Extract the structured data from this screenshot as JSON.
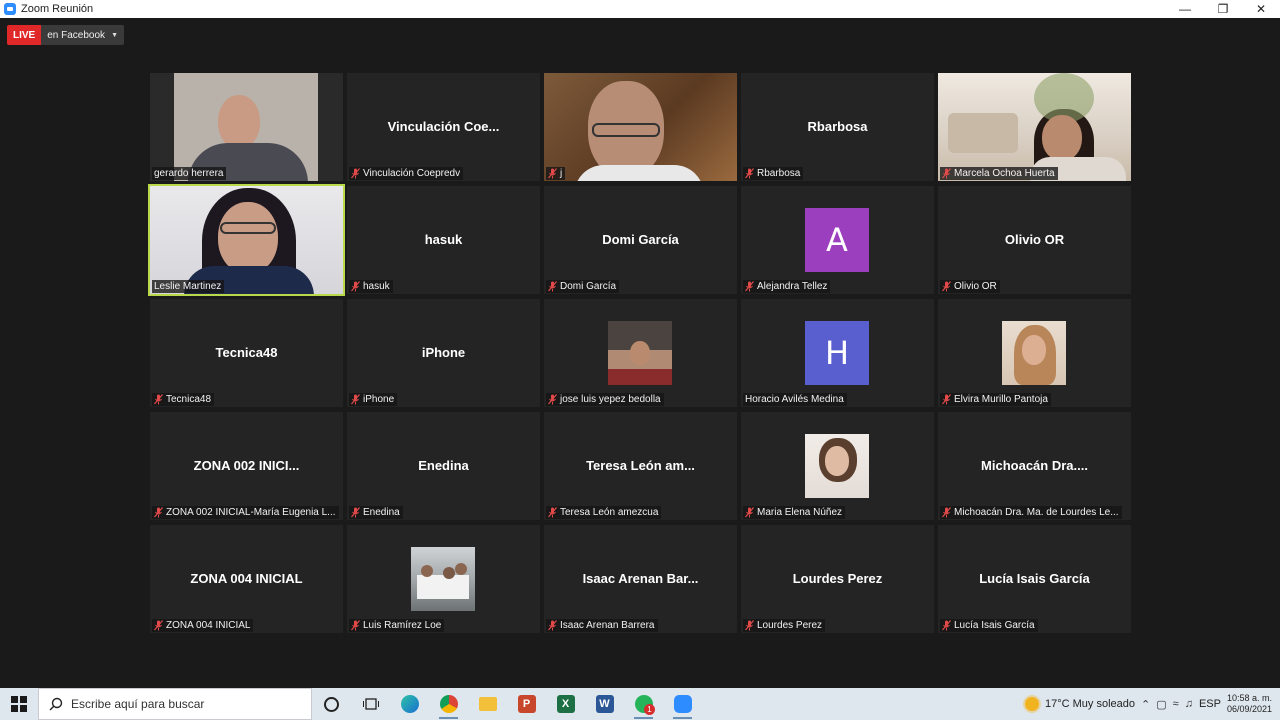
{
  "window": {
    "title": "Zoom Reunión"
  },
  "live": {
    "badge": "LIVE",
    "platform": "en Facebook"
  },
  "participants": [
    {
      "label": "gerardo herrera",
      "video": "gerardo",
      "muted": false
    },
    {
      "display": "Vinculación Coe...",
      "label": "Vinculación Coepredv",
      "muted": true
    },
    {
      "label": "j",
      "video": "hom2",
      "muted": true
    },
    {
      "display": "Rbarbosa",
      "label": "Rbarbosa",
      "muted": true
    },
    {
      "label": "Marcela Ochoa Huerta",
      "video": "marcela",
      "muted": true
    },
    {
      "label": "Leslie Martinez",
      "video": "leslie",
      "muted": false,
      "active_speaker": true
    },
    {
      "display": "hasuk",
      "label": "hasuk",
      "muted": true
    },
    {
      "display": "Domi García",
      "label": "Domi García",
      "muted": true
    },
    {
      "avatar": "A",
      "avatar_color": "#9b3fbf",
      "label": "Alejandra Tellez",
      "muted": true
    },
    {
      "display": "Olivio OR",
      "label": "Olivio OR",
      "muted": true
    },
    {
      "display": "Tecnica48",
      "label": "Tecnica48",
      "muted": true
    },
    {
      "display": "iPhone",
      "label": "iPhone",
      "muted": true
    },
    {
      "photo": "jose",
      "label": "jose luis yepez bedolla",
      "muted": true
    },
    {
      "avatar": "H",
      "avatar_color": "#5a5fcf",
      "label": "Horacio Avilés Medina",
      "muted": false
    },
    {
      "photo": "elvira",
      "label": "Elvira Murillo Pantoja",
      "muted": true
    },
    {
      "display": "ZONA 002 INICI...",
      "label": "ZONA 002 INICIAL-María Eugenia L...",
      "muted": true
    },
    {
      "display": "Enedina",
      "label": "Enedina",
      "muted": true
    },
    {
      "display": "Teresa León  am...",
      "label": "Teresa León  amezcua",
      "muted": true
    },
    {
      "photo": "maria",
      "label": "Maria Elena Núñez",
      "muted": true
    },
    {
      "display": "Michoacán Dra....",
      "label": "Michoacán Dra. Ma. de Lourdes Le...",
      "muted": true
    },
    {
      "display": "ZONA 004 INICIAL",
      "label": "ZONA 004 INICIAL",
      "muted": true
    },
    {
      "photo": "luis",
      "label": "Luis Ramírez Loe",
      "muted": true
    },
    {
      "display": "Isaac Arenan Bar...",
      "label": "Isaac Arenan Barrera",
      "muted": true
    },
    {
      "display": "Lourdes Perez",
      "label": "Lourdes Perez",
      "muted": true
    },
    {
      "display": "Lucía Isais García",
      "label": "Lucía Isais García",
      "muted": true
    }
  ],
  "taskbar": {
    "search_placeholder": "Escribe aquí para buscar",
    "weather": "17°C  Muy soleado",
    "language": "ESP",
    "time": "10:58 a. m.",
    "date": "06/09/2021",
    "whatsapp_badge": "1"
  }
}
